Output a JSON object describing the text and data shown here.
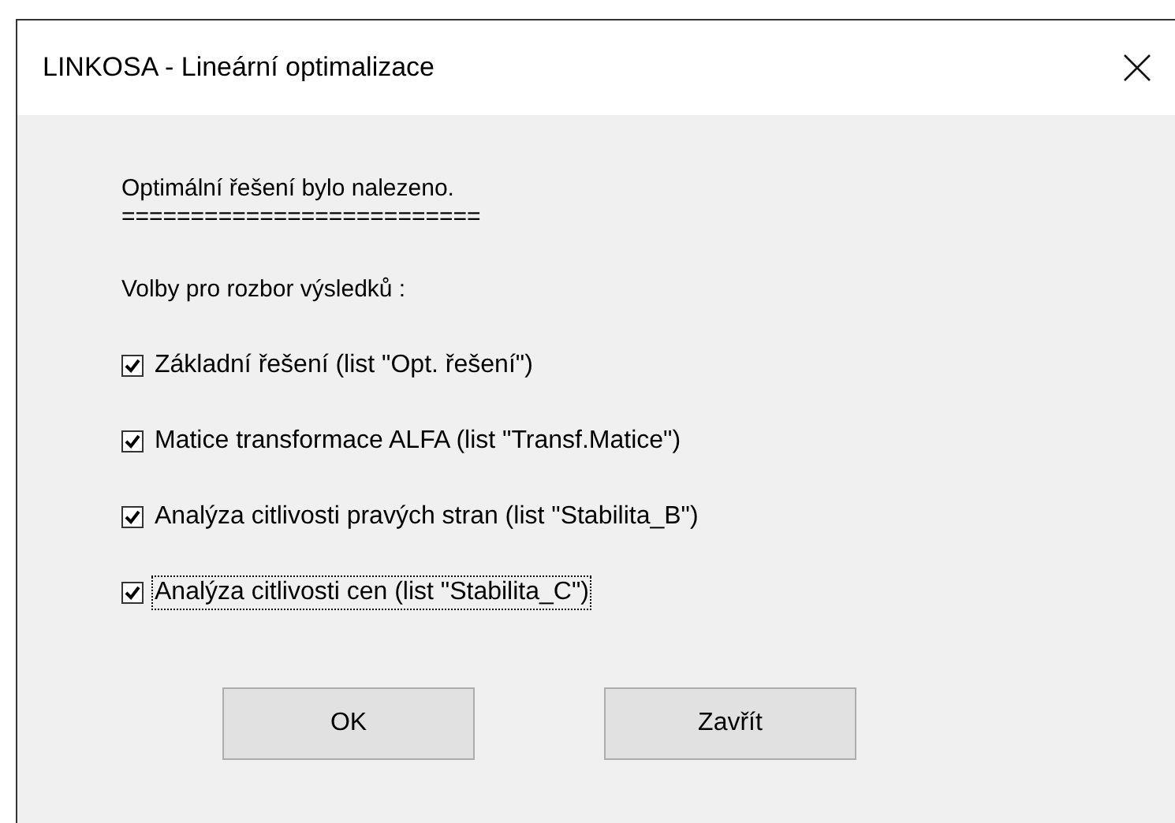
{
  "window": {
    "title": "LINKOSA - Lineární optimalizace"
  },
  "message": "Optimální řešení bylo nalezeno.",
  "separator": "==========================",
  "options_heading": "Volby pro rozbor výsledků :",
  "options": [
    {
      "label": "Základní řešení (list \"Opt. řešení\")",
      "checked": true,
      "focused": false
    },
    {
      "label": "Matice transformace ALFA (list \"Transf.Matice\")",
      "checked": true,
      "focused": false
    },
    {
      "label": "Analýza citlivosti pravých stran (list \"Stabilita_B\")",
      "checked": true,
      "focused": false
    },
    {
      "label": "Analýza citlivosti cen (list \"Stabilita_C\")",
      "checked": true,
      "focused": true
    }
  ],
  "buttons": [
    "OK",
    "Zavřít"
  ]
}
